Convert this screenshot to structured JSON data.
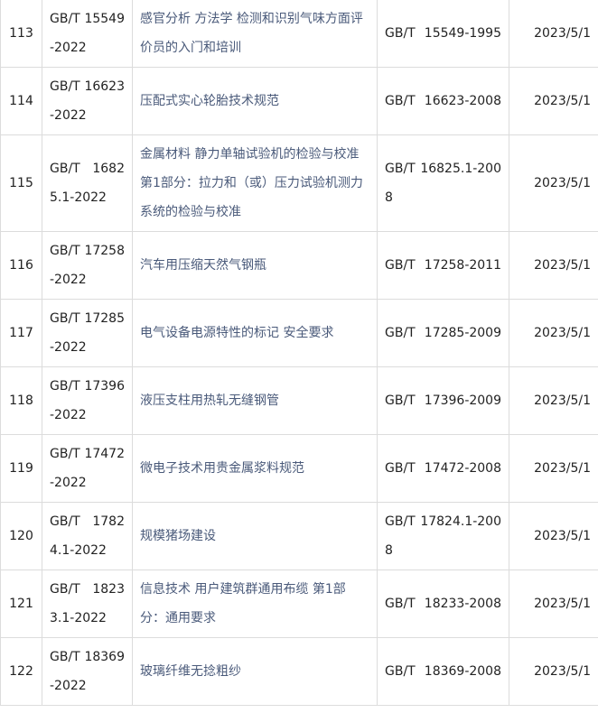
{
  "table": {
    "rows": [
      {
        "no": "113",
        "code": "GB/T 15549-2022",
        "title": "感官分析 方法学 检测和识别气味方面评价员的入门和培训",
        "replaced": "GB/T 15549-1995",
        "date": "2023/5/1"
      },
      {
        "no": "114",
        "code": "GB/T 16623-2022",
        "title": "压配式实心轮胎技术规范",
        "replaced": "GB/T 16623-2008",
        "date": "2023/5/1"
      },
      {
        "no": "115",
        "code": "GB/T 16825.1-2022",
        "title": "金属材料 静力单轴试验机的检验与校准 第1部分：拉力和（或）压力试验机测力系统的检验与校准",
        "replaced": "GB/T 16825.1-2008",
        "date": "2023/5/1"
      },
      {
        "no": "116",
        "code": "GB/T 17258-2022",
        "title": "汽车用压缩天然气钢瓶",
        "replaced": "GB/T 17258-2011",
        "date": "2023/5/1"
      },
      {
        "no": "117",
        "code": "GB/T 17285-2022",
        "title": "电气设备电源特性的标记 安全要求",
        "replaced": "GB/T 17285-2009",
        "date": "2023/5/1"
      },
      {
        "no": "118",
        "code": "GB/T 17396-2022",
        "title": "液压支柱用热轧无缝钢管",
        "replaced": "GB/T 17396-2009",
        "date": "2023/5/1"
      },
      {
        "no": "119",
        "code": "GB/T 17472-2022",
        "title": "微电子技术用贵金属浆料规范",
        "replaced": "GB/T 17472-2008",
        "date": "2023/5/1"
      },
      {
        "no": "120",
        "code": "GB/T 17824.1-2022",
        "title": "规模猪场建设",
        "replaced": "GB/T 17824.1-2008",
        "date": "2023/5/1"
      },
      {
        "no": "121",
        "code": "GB/T 18233.1-2022",
        "title": "信息技术 用户建筑群通用布缆 第1部分：通用要求",
        "replaced": "GB/T 18233-2008",
        "date": "2023/5/1"
      },
      {
        "no": "122",
        "code": "GB/T 18369-2022",
        "title": "玻璃纤维无捻粗纱",
        "replaced": "GB/T 18369-2008",
        "date": "2023/5/1"
      }
    ]
  }
}
